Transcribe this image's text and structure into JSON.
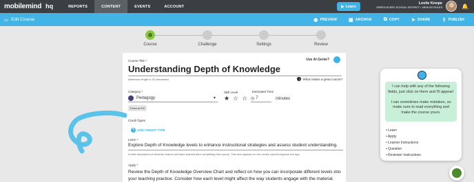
{
  "nav": {
    "logo": "mobilemind",
    "logo_suffix": "hq",
    "items": [
      {
        "label": "REPORTS",
        "active": false
      },
      {
        "label": "CONTENT",
        "active": true
      },
      {
        "label": "EVENTS",
        "active": false
      },
      {
        "label": "ACCOUNT",
        "active": false
      }
    ],
    "learn_label": "Learn",
    "user_name": "Leslie Knope",
    "school": "GREEN ACRES SCHOOL DISTRICT • VIEW AS ROLES"
  },
  "toolbar": {
    "title": "Edit Course",
    "actions": [
      "PREVIEW",
      "ARCHIVE",
      "COPY",
      "SHARE",
      "PUBLISH"
    ]
  },
  "stepper": {
    "steps": [
      {
        "label": "Course",
        "done": true
      },
      {
        "label": "Challenge",
        "done": false
      },
      {
        "label": "Settings",
        "done": false
      },
      {
        "label": "Review",
        "done": false
      }
    ]
  },
  "form": {
    "ai_genie": "Use AI Genie?",
    "course_title_label": "Course Title *",
    "course_title": "Understanding Depth of Knowledge",
    "max_length": "Maximum length is 30 characters.",
    "what_makes": "What makes a great course?",
    "category_label": "Category *",
    "category": "Pedagogy",
    "skill_label": "Skill Level",
    "skill_level": 1,
    "time_label": "Estimated Time",
    "time_value": "7",
    "time_unit": "minutes",
    "chip": "External PD",
    "credit_label": "Credit Types",
    "add_credit": "ADD CREDIT TYPE",
    "learn_label": "Learn *",
    "learn_text": "Explore Depth of Knowledge levels to enhance instructional strategies and assess student understanding.",
    "learn_hint": "A brief description of what the learner will have learned after completing this course. This text appears on the course card throughout the app.",
    "apply_label": "Apply *",
    "apply_text": "Review the Depth of Knowledge Overview Chart and reflect on how you can incorporate different levels into your teaching practice. Consider how each level might affect the way students engage with the material. Then click"
  },
  "helper": {
    "message": "I can help with any of the following fields, just click on them and I'll appear! I can sometimes make mistakes, so make sure to read everything and make the course yours.",
    "message_1": "I can help with any of the following fields, just click on them and I'll appear!",
    "message_2": "I can sometimes make mistakes, so make sure to read everything and make the course yours.",
    "items": [
      "Learn",
      "Apply",
      "Learner Instructions",
      "Question",
      "Reviewer Instructions"
    ]
  },
  "colors": {
    "nav": "#3b3f44",
    "accent": "#44b3e6",
    "step_done": "#8cc63f",
    "bubble": "#c8f0d8"
  }
}
